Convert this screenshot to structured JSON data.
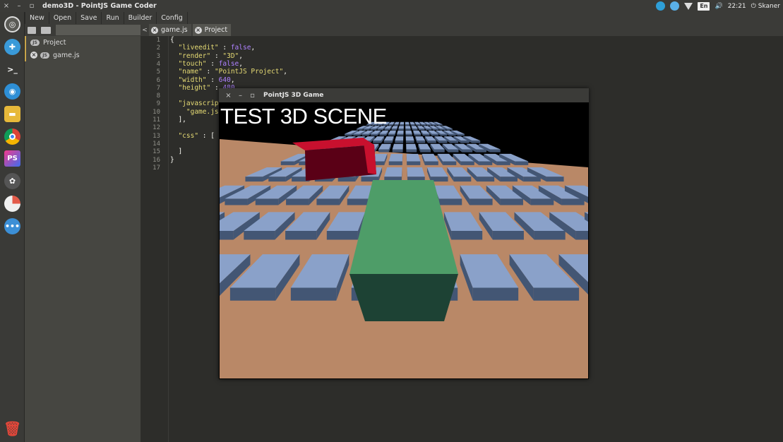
{
  "titlebar": {
    "app_title": "demo3D - PointJS Game Coder",
    "close": "×",
    "minimize": "–",
    "maximize": "▫"
  },
  "tray": {
    "lang": "En",
    "volume": "🔊",
    "clock": "22:21",
    "user": "Skaner"
  },
  "menubar": {
    "items": [
      "New",
      "Open",
      "Save",
      "Run",
      "Builder",
      "Config"
    ]
  },
  "sidebar": {
    "items": [
      {
        "badge": "JS",
        "label": "Project",
        "closable": false
      },
      {
        "badge": "JS",
        "label": "game.js",
        "closable": true
      }
    ]
  },
  "editor": {
    "nav": "<",
    "tabs": [
      {
        "label": "game.js",
        "active": false
      },
      {
        "label": "Project",
        "active": true
      }
    ],
    "line_numbers": [
      "1",
      "2",
      "3",
      "4",
      "5",
      "6",
      "7",
      "8",
      "9",
      "10",
      "11",
      "12",
      "13",
      "14",
      "15",
      "16",
      "17"
    ]
  },
  "code": [
    "{",
    "  \"liveedit\" : false,",
    "  \"render\" : \"3D\",",
    "  \"touch\" : false,",
    "  \"name\" : \"PointJS Project\",",
    "  \"width\" : 640,",
    "  \"height\" : 480,",
    "",
    "  \"javascript\" : [",
    "    \"game.js\"",
    "  ],",
    "",
    "  \"css\" : [",
    "",
    "  ]",
    "}",
    ""
  ],
  "game_window": {
    "title": "PointJS 3D Game",
    "close": "×",
    "minimize": "–",
    "maximize": "▫",
    "scene_text": "TEST 3D SCENE",
    "colors": {
      "sky": "#000000",
      "ground": "#b98867",
      "tile_top": "#8aa1c9",
      "tile_side": "#435674",
      "red_top": "#c8102e",
      "red_side": "#5a0016",
      "green_top": "#4e9d68",
      "green_front": "#1d4234"
    }
  }
}
